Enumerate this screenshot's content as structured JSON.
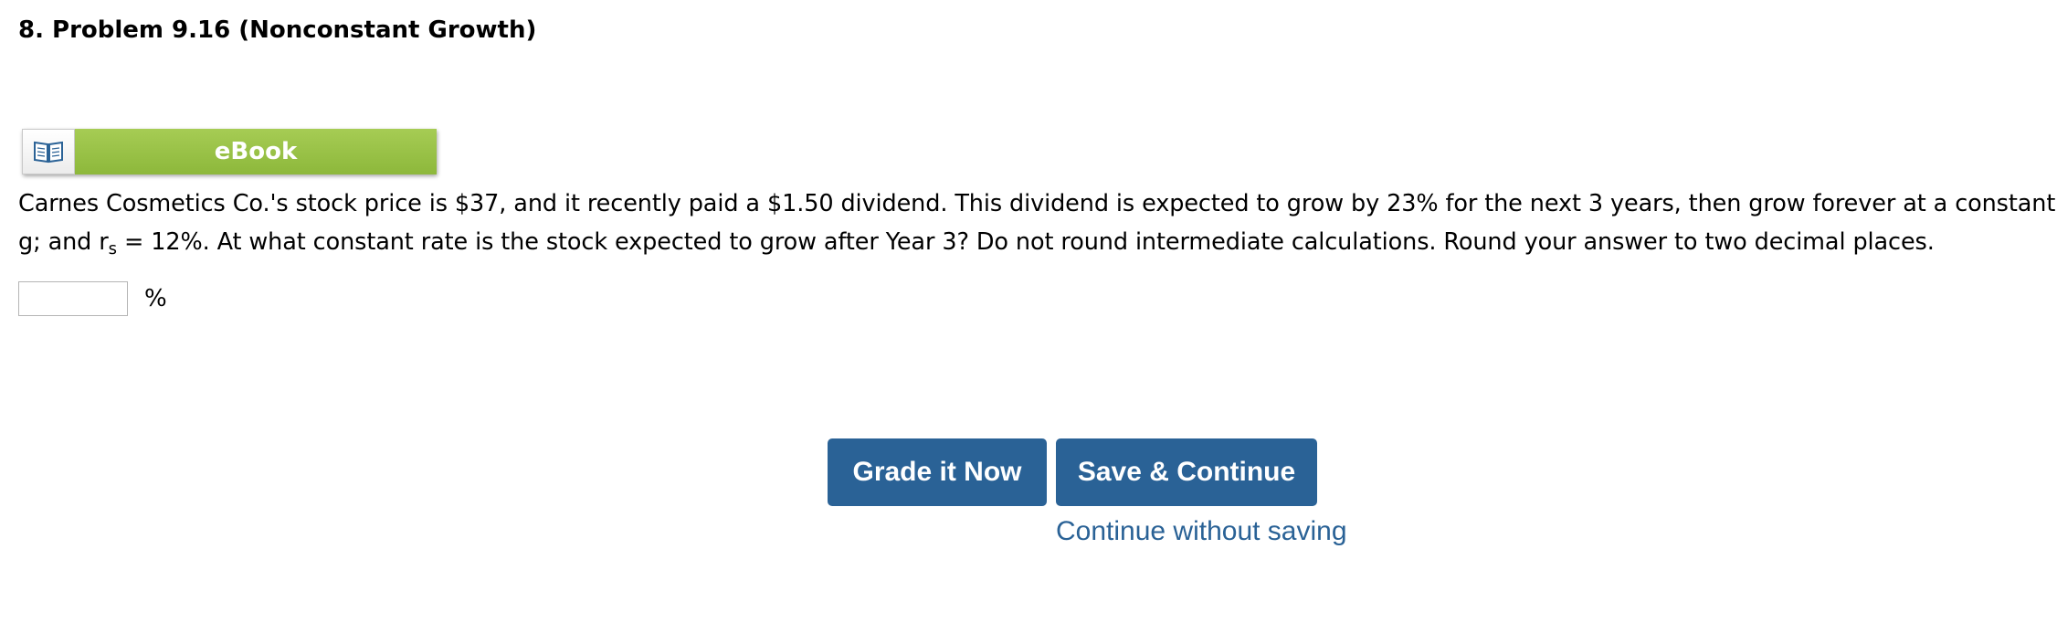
{
  "problem": {
    "title": "8.  Problem 9.16 (Nonconstant Growth)"
  },
  "ebook": {
    "icon": "book-icon",
    "label": "eBook"
  },
  "question": {
    "line1": "Carnes Cosmetics Co.'s stock price is $37, and it recently paid a $1.50 dividend. This dividend is expected to grow by 23% for the next 3 years, then grow forever at a constant rate,",
    "line2_prefix": "g; and r",
    "line2_subscript": "s",
    "line2_suffix": " = 12%. At what constant rate is the stock expected to grow after Year 3? Do not round intermediate calculations. Round your answer to two decimal places."
  },
  "answer": {
    "value": "",
    "unit": "%"
  },
  "actions": {
    "grade_label": "Grade it Now",
    "save_label": "Save & Continue",
    "continue_label": "Continue without saving"
  },
  "colors": {
    "ebook_green": "#9dc44b",
    "button_blue": "#2a6296",
    "link_blue": "#2a6296"
  }
}
